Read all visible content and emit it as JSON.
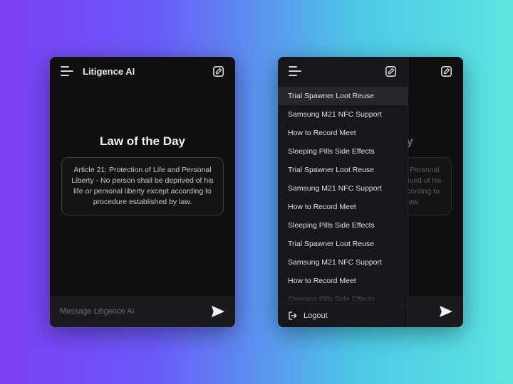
{
  "app": {
    "title": "Litigence AI"
  },
  "law": {
    "heading": "Law of the Day",
    "body": "Article 21: Protection of Life and Personal Liberty - No person shall be deprived of his life or personal liberty except according to procedure established by law."
  },
  "input": {
    "placeholder": "Message Litigence AI"
  },
  "sidebar": {
    "items": [
      "Trial Spawner Loot Reuse",
      "Samsung M21 NFC Support",
      "How to Record Meet",
      "Sleeping Pills Side Effects",
      "Trial Spawner Loot Reuse",
      "Samsung M21 NFC Support",
      "How to Record Meet",
      "Sleeping Pills Side Effects",
      "Trial Spawner Loot Reuse",
      "Samsung M21 NFC Support",
      "How to Record Meet",
      "Sleeping Pills Side Effects"
    ],
    "active_index": 0,
    "logout_label": "Logout"
  },
  "colors": {
    "bg_dark": "#0f0f11",
    "panel": "#17171b",
    "text": "#e8e8ea",
    "muted": "#6c6c74"
  }
}
